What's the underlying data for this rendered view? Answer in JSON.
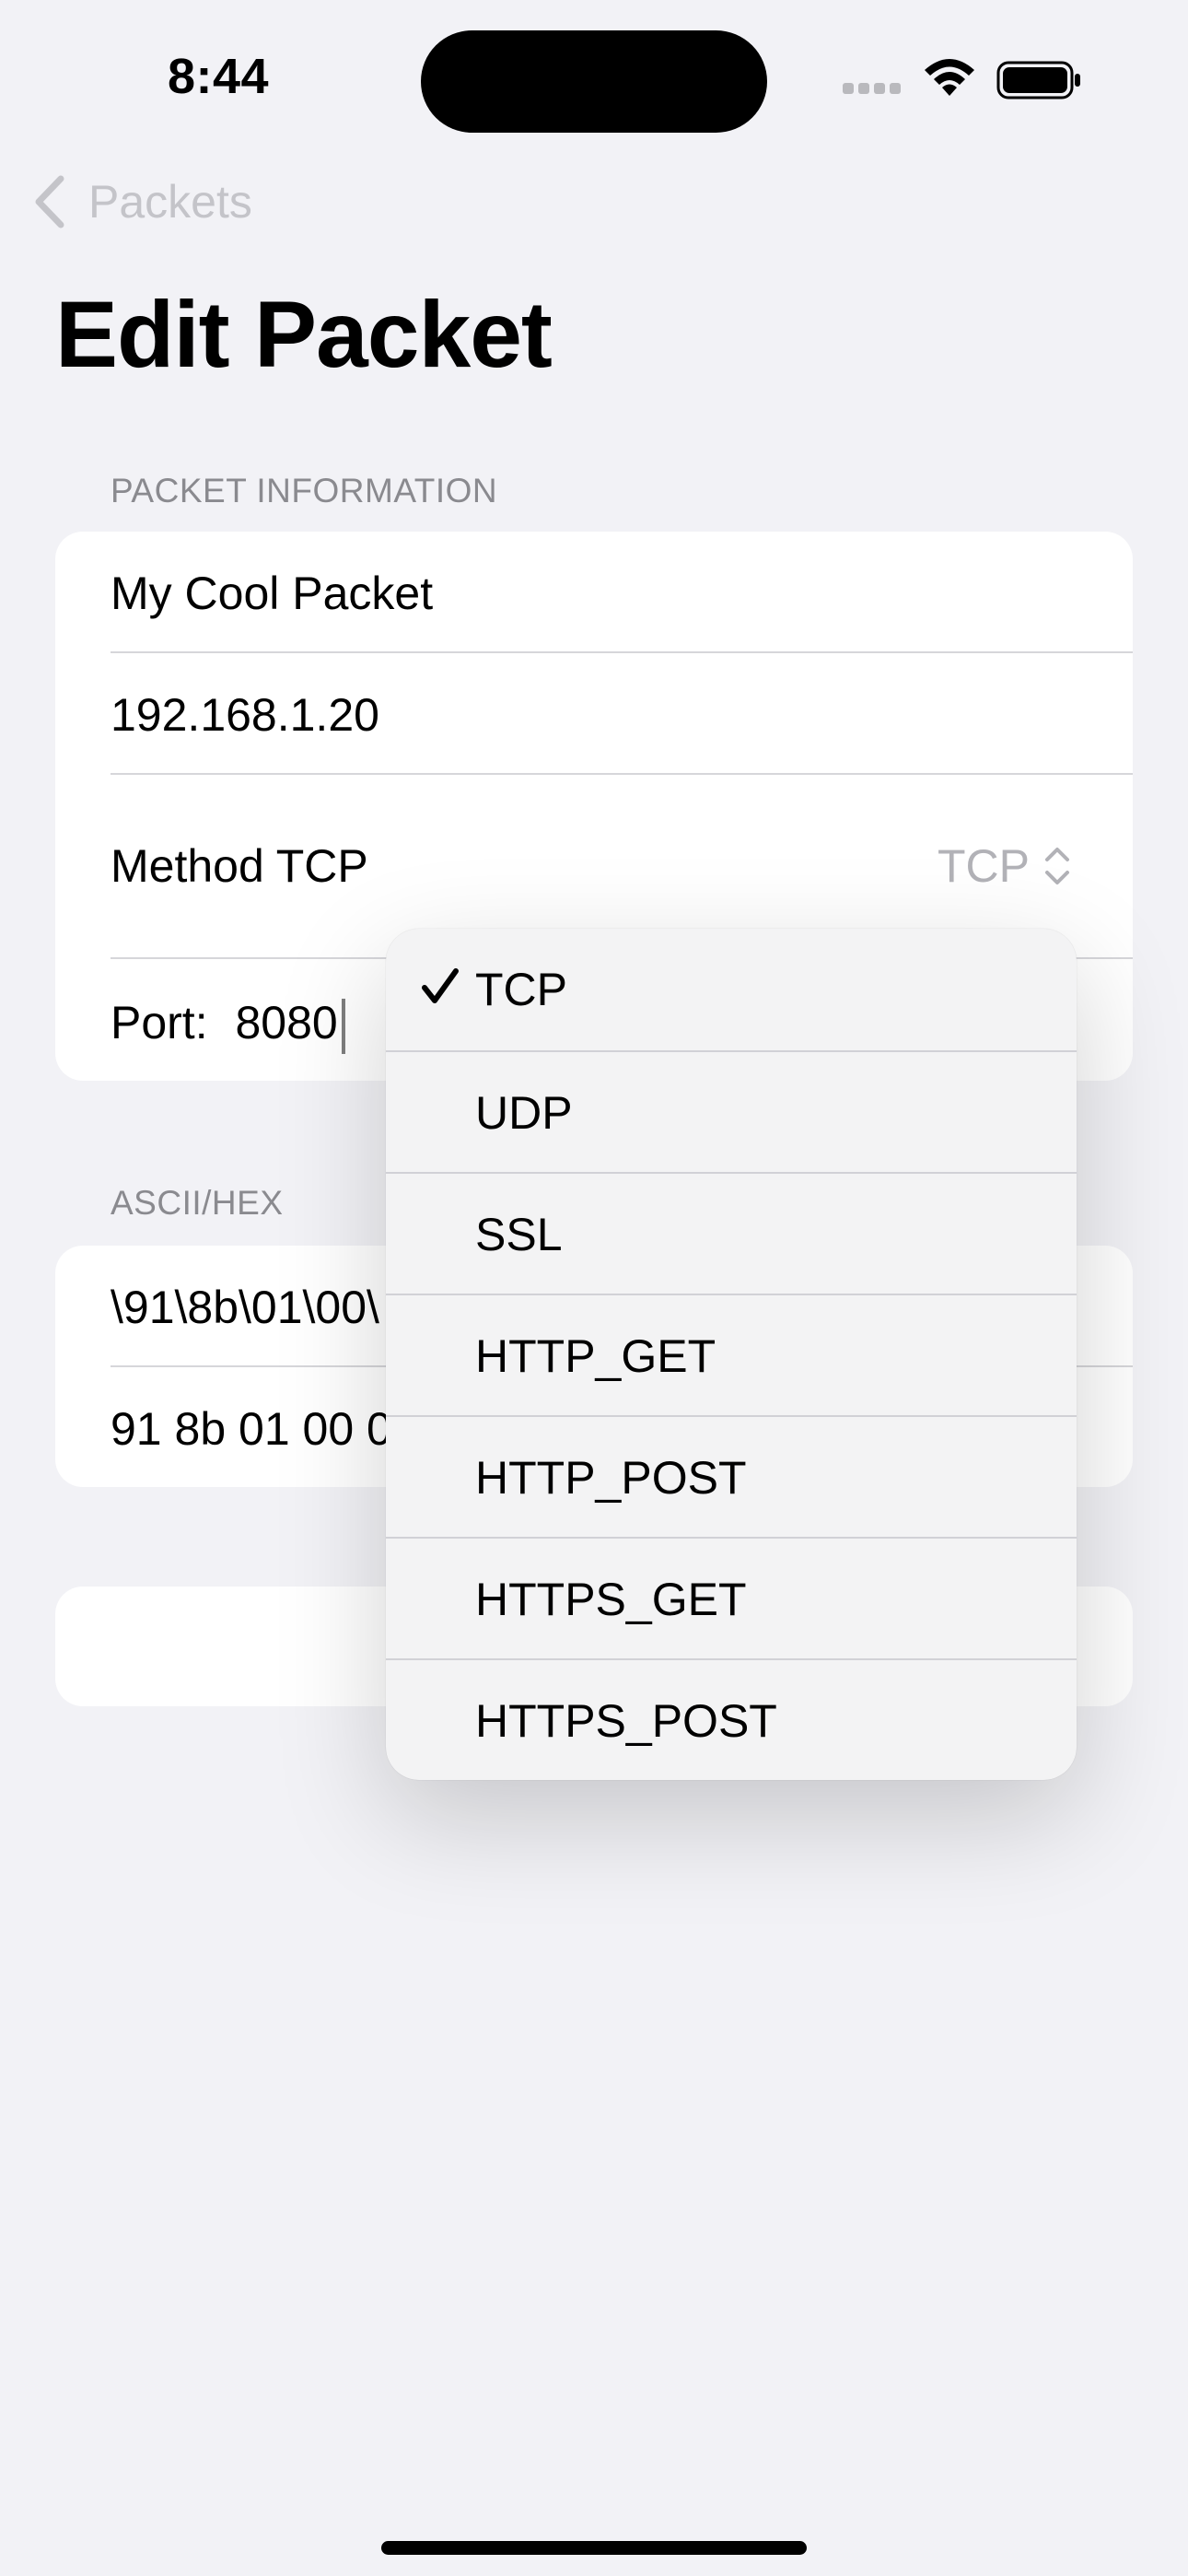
{
  "status_bar": {
    "time": "8:44"
  },
  "nav": {
    "back_label": "Packets",
    "title": "Edit Packet"
  },
  "packet_info": {
    "header": "PACKET INFORMATION",
    "name_value": "My Cool Packet",
    "ip_value": "192.168.1.20",
    "method_label": "Method TCP",
    "method_value": "TCP",
    "port_label": "Port:",
    "port_value": "8080"
  },
  "ascii_hex": {
    "header": "ASCII/HEX",
    "ascii_value": "\\91\\8b\\01\\00\\",
    "hex_value": "91 8b 01 00 0"
  },
  "method_menu": {
    "selected": "TCP",
    "options": [
      "TCP",
      "UDP",
      "SSL",
      "HTTP_GET",
      "HTTP_POST",
      "HTTPS_GET",
      "HTTPS_POST"
    ]
  }
}
